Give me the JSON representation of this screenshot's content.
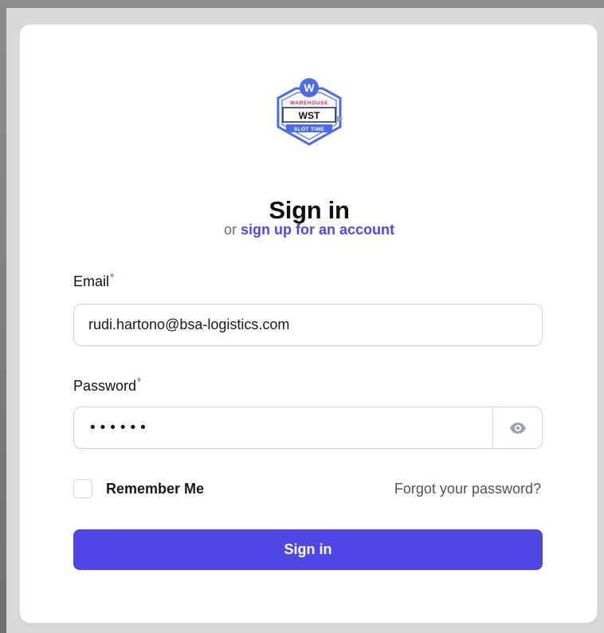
{
  "brand": {
    "logo_top_text": "WAREHOUSE",
    "logo_main_text": "WST",
    "logo_bottom_text": "SLOT TIME",
    "logo_badge_letter": "W",
    "colors": {
      "blue": "#4b6bea",
      "red": "#d61f4f",
      "accent": "#4f46e5"
    }
  },
  "header": {
    "title": "Sign in",
    "subtitle_prefix": "or",
    "signup_link": "sign up for an account"
  },
  "form": {
    "email": {
      "label": "Email",
      "required_mark": "*",
      "value": "rudi.hartono@bsa-logistics.com"
    },
    "password": {
      "label": "Password",
      "required_mark": "*",
      "value": "••••••",
      "toggle_icon": "eye-icon"
    },
    "remember_label": "Remember Me",
    "remember_checked": false,
    "forgot_link": "Forgot your password?",
    "submit_label": "Sign in"
  }
}
